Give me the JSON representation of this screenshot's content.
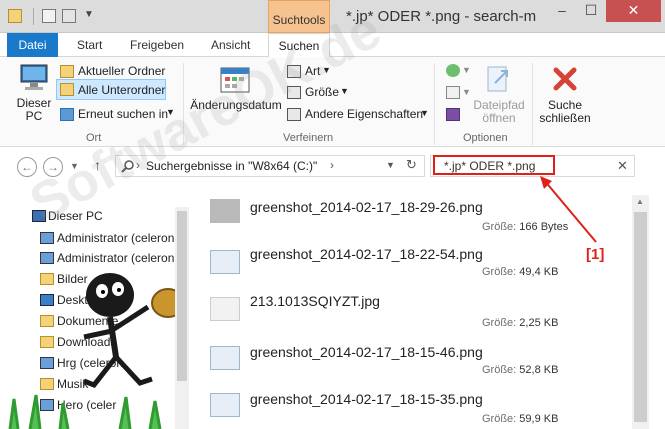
{
  "titlebar": {
    "contextual_tab": "Suchtools",
    "window_title": "*.jp* ODER *.png - search-m",
    "minimize": "–",
    "maximize": "☐",
    "close": "✕"
  },
  "ribbon_tabs": {
    "file": "Datei",
    "start": "Start",
    "share": "Freigeben",
    "view": "Ansicht",
    "search": "Suchen"
  },
  "ribbon": {
    "location": {
      "this_pc": "Dieser\nPC",
      "current_folder": "Aktueller Ordner",
      "all_subfolders": "Alle Unterordner",
      "search_again": "Erneut suchen in",
      "group": "Ort"
    },
    "refine": {
      "date_modified": "Änderungsdatum",
      "kind": "Art",
      "size": "Größe",
      "other_properties": "Andere Eigenschaften",
      "group": "Verfeinern"
    },
    "options": {
      "open_file_location": "Dateipfad\nöffnen",
      "group": "Optionen"
    },
    "close_search": "Suche\nschließen"
  },
  "address": {
    "path": "Suchergebnisse in \"W8x64 (C:)\"",
    "search_query": "*.jp* ODER *.png"
  },
  "nav_pane": {
    "items": [
      "Dieser PC",
      "Administrator (celeron",
      "Administrator (celeron",
      "Bilder",
      "Desktop",
      "Dokumente",
      "Downloads",
      "Hrg (celeron",
      "Musik",
      "Hero (celer"
    ]
  },
  "results": [
    {
      "name": "greenshot_2014-02-17_18-29-26.png",
      "size_label": "Größe:",
      "size": "166 Bytes"
    },
    {
      "name": "greenshot_2014-02-17_18-22-54.png",
      "size_label": "Größe:",
      "size": "49,4 KB"
    },
    {
      "name": "213.1013SQIYZT.jpg",
      "size_label": "Größe:",
      "size": "2,25 KB"
    },
    {
      "name": "greenshot_2014-02-17_18-15-46.png",
      "size_label": "Größe:",
      "size": "52,8 KB"
    },
    {
      "name": "greenshot_2014-02-17_18-15-35.png",
      "size_label": "Größe:",
      "size": "59,9 KB"
    }
  ],
  "annotation": {
    "label": "[1]",
    "color": "#e0201a"
  },
  "watermark": "SoftwareOK.de",
  "colors": {
    "file_tab": "#1979ca",
    "contextual_tab": "#f6c28f",
    "close_button": "#c75050",
    "selected_option": "#cde8ff"
  }
}
